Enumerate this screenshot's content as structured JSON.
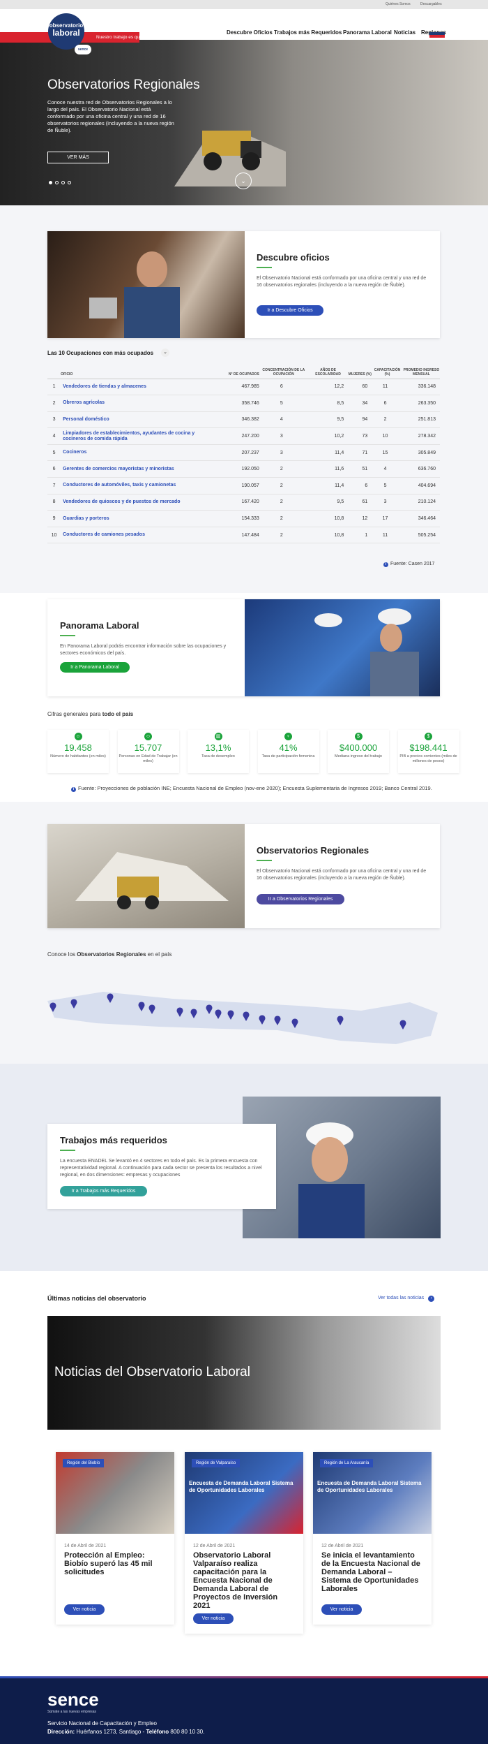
{
  "topbar": {
    "who": "Quiénes Somos",
    "downloads": "Descargables"
  },
  "header": {
    "logo_line1": "observatorio",
    "logo_line2": "laboral",
    "sence": "sence",
    "tagline": "Nuestro trabajo es que descubras el tuyo",
    "nav": [
      "Descubre Oficios",
      "Trabajos más Requeridos",
      "Panorama Laboral",
      "Noticias",
      "Regiones"
    ]
  },
  "hero": {
    "title": "Observatorios Regionales",
    "text": "Conoce nuestra red de Observatorios Regionales a lo largo del país. El Observatorio Nacional está conformado por una oficina central y una red de 16 observatorios regionales (incluyendo a la nueva región de Ñuble).",
    "button": "VER MÁS"
  },
  "descubre": {
    "title": "Descubre oficios",
    "text": "El Observatorio Nacional está conformado por una oficina central y una red de 16 observatorios regionales (incluyendo a la nueva región de Ñuble).",
    "button": "Ir a Descubre Oficios"
  },
  "table": {
    "title": "Las 10 Ocupaciones con más ocupados",
    "headers": [
      "",
      "OFICIO",
      "N° DE OCUPADOS",
      "CONCENTRACIÓN DE LA OCUPACIÓN",
      "AÑOS DE ESCOLARIDAD",
      "MUJERES (%)",
      "CAPACITACIÓN (%)",
      "PROMEDIO INGRESO MENSUAL"
    ],
    "rows": [
      [
        "1",
        "Vendedores de tiendas y almacenes",
        "467.985",
        "6",
        "12,2",
        "60",
        "11",
        "336.148"
      ],
      [
        "2",
        "Obreros agrícolas",
        "358.746",
        "5",
        "8,5",
        "34",
        "6",
        "263.350"
      ],
      [
        "3",
        "Personal doméstico",
        "346.382",
        "4",
        "9,5",
        "94",
        "2",
        "251.813"
      ],
      [
        "4",
        "Limpiadores de establecimientos, ayudantes de cocina y cocineros de comida rápida",
        "247.200",
        "3",
        "10,2",
        "73",
        "10",
        "278.342"
      ],
      [
        "5",
        "Cocineros",
        "207.237",
        "3",
        "11,4",
        "71",
        "15",
        "305.849"
      ],
      [
        "6",
        "Gerentes de comercios mayoristas y minoristas",
        "192.050",
        "2",
        "11,6",
        "51",
        "4",
        "636.760"
      ],
      [
        "7",
        "Conductores de automóviles, taxis y camionetas",
        "190.057",
        "2",
        "11,4",
        "6",
        "5",
        "404.694"
      ],
      [
        "8",
        "Vendedores de quioscos y de puestos de mercado",
        "167.420",
        "2",
        "9,5",
        "61",
        "3",
        "210.124"
      ],
      [
        "9",
        "Guardias y porteros",
        "154.333",
        "2",
        "10,8",
        "12",
        "17",
        "346.464"
      ],
      [
        "10",
        "Conductores de camiones pesados",
        "147.484",
        "2",
        "10,8",
        "1",
        "11",
        "505.254"
      ]
    ],
    "source": "Fuente: Casen 2017"
  },
  "panorama": {
    "title": "Panorama Laboral",
    "text": "En Panorama Laboral podrás encontrar información sobre las ocupaciones y sectores económicos del país.",
    "button": "Ir a Panorama Laboral"
  },
  "cifras": {
    "label": "Cifras generales para",
    "label_bold": "todo el país",
    "stats": [
      {
        "value": "19.458",
        "label": "Número de habitantes (en miles)"
      },
      {
        "value": "15.707",
        "label": "Personas en Edad de Trabajar (en miles)"
      },
      {
        "value": "13,1%",
        "label": "Tasa de desempleo"
      },
      {
        "value": "41%",
        "label": "Tasa de participación femenina"
      },
      {
        "value": "$400.000",
        "label": "Mediana ingreso del trabajo"
      },
      {
        "value": "$198.441",
        "label": "PIB a precios corrientes (miles de millones de pesos)"
      }
    ],
    "source": "Fuente: Proyecciones de población INE; Encuesta Nacional de Empleo (nov-ene 2020); Encuesta Suplementaria de Ingresos 2019; Banco Central 2019."
  },
  "regionales": {
    "title": "Observatorios Regionales",
    "text": "El Observatorio Nacional está conformado por una oficina central y una red de 16 observatorios regionales (incluyendo a la nueva región de Ñuble).",
    "button": "Ir a Observatorios Regionales",
    "map_label": "Conoce los",
    "map_bold": "Observatorios Regionales",
    "map_suffix": "en el país"
  },
  "trabajos": {
    "title": "Trabajos más requeridos",
    "text": "La encuesta ENADEL Se levantó en 4 sectores en todo el país. Es la primera encuesta con representatividad regional. A continuación para cada sector se presenta los resultados a nivel regional, en dos dimensiones: empresas y ocupaciones",
    "button": "Ir a Trabajos más Requeridos"
  },
  "news": {
    "heading": "Últimas noticias del observatorio",
    "see_all": "Ver todas las noticias",
    "banner": "Noticias del Observatorio Laboral",
    "items": [
      {
        "region": "Región del Biobío",
        "date": "14 de Abril de 2021",
        "title": "Protección al Empleo: Biobío superó las 45 mil solicitudes",
        "button": "Ver noticia",
        "img_text": ""
      },
      {
        "region": "Región de Valparaíso",
        "date": "12 de Abril de 2021",
        "title": "Observatorio Laboral Valparaíso realiza capacitación para la Encuesta Nacional de Demanda Laboral de Proyectos de Inversión 2021",
        "button": "Ver noticia",
        "img_text": "Encuesta de Demanda Laboral Sistema de Oportunidades Laborales"
      },
      {
        "region": "Región de La Araucanía",
        "date": "12 de Abril de 2021",
        "title": "Se inicia el levantamiento de la Encuesta Nacional de Demanda Laboral – Sistema de Oportunidades Laborales",
        "button": "Ver noticia",
        "img_text": "Encuesta de Demanda Laboral Sistema de Oportunidades Laborales"
      }
    ]
  },
  "footer": {
    "brand": "sence",
    "slogan": "Súmate a las nuevas empresas",
    "org": "Servicio Nacional de Capacitación y Empleo",
    "address_label": "Dirección:",
    "address": "Huérfanos 1273, Santiago -",
    "phone_label": "Teléfono",
    "phone": "800 80 10 30."
  },
  "colors": {
    "primary": "#2d4fb8",
    "green": "#1aa33a",
    "red": "#d9232e",
    "navy": "#0e1d4a"
  }
}
